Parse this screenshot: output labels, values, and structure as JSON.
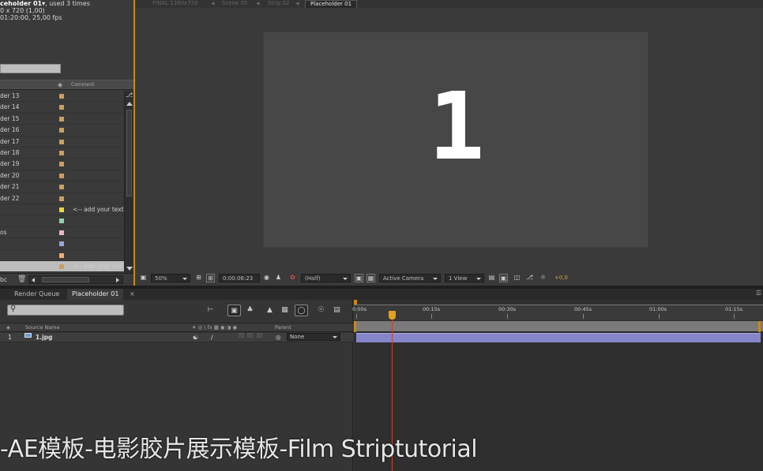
{
  "project": {
    "info_name": "ceholder 01▾",
    "info_used": ", used 3 times",
    "info_line2": "0 x 720 (1,00)",
    "info_line3": "01:20:00, 25,00 fps",
    "column_comment": "Comment",
    "rows": [
      {
        "name": "der 13",
        "color": "#c9a060",
        "comment": ""
      },
      {
        "name": "der 14",
        "color": "#c9a060",
        "comment": ""
      },
      {
        "name": "der 15",
        "color": "#c9a060",
        "comment": ""
      },
      {
        "name": "der 16",
        "color": "#c9a060",
        "comment": ""
      },
      {
        "name": "der 17",
        "color": "#c9a060",
        "comment": ""
      },
      {
        "name": "der 18",
        "color": "#c9a060",
        "comment": ""
      },
      {
        "name": "der 19",
        "color": "#c9a060",
        "comment": ""
      },
      {
        "name": "der 20",
        "color": "#c9a060",
        "comment": ""
      },
      {
        "name": "der 21",
        "color": "#c9a060",
        "comment": ""
      },
      {
        "name": "der 22",
        "color": "#c9a060",
        "comment": ""
      },
      {
        "name": "",
        "color": "#e8d840",
        "comment": "<-- add your text"
      },
      {
        "name": "",
        "color": "#8fd0b0",
        "comment": ""
      },
      {
        "name": "os",
        "color": "#e8b8c0",
        "comment": ""
      },
      {
        "name": "",
        "color": "#9aa6d8",
        "comment": ""
      },
      {
        "name": "",
        "color": "#f0b070",
        "comment": ""
      },
      {
        "name": "",
        "color": "#c9a060",
        "comment": "<-- add your mu"
      }
    ],
    "footer_bpc": "bc"
  },
  "viewer": {
    "breadcrumbs": [
      "FINAL 1280x720",
      "Scene 05",
      "Strip 02",
      "Placeholder 01"
    ],
    "frame_text": "1",
    "zoom": "50%",
    "timecode": "0:00:06:23",
    "resolution": "(Half)",
    "camera": "Active Camera",
    "views": "1 View",
    "exposure": "+0,0"
  },
  "timeline": {
    "tabs": [
      "Render Queue",
      "Placeholder 01"
    ],
    "columns": {
      "source_name": "Source Name",
      "parent": "Parent"
    },
    "layer": {
      "index": "1",
      "name": "1.jpg",
      "parent": "None"
    },
    "ruler_labels": [
      "0:00s",
      "00:15s",
      "00:30s",
      "00:45s",
      "01:00s",
      "01:15s"
    ]
  },
  "caption": "-AE模板-电影胶片展示模板-Film Striptutorial"
}
